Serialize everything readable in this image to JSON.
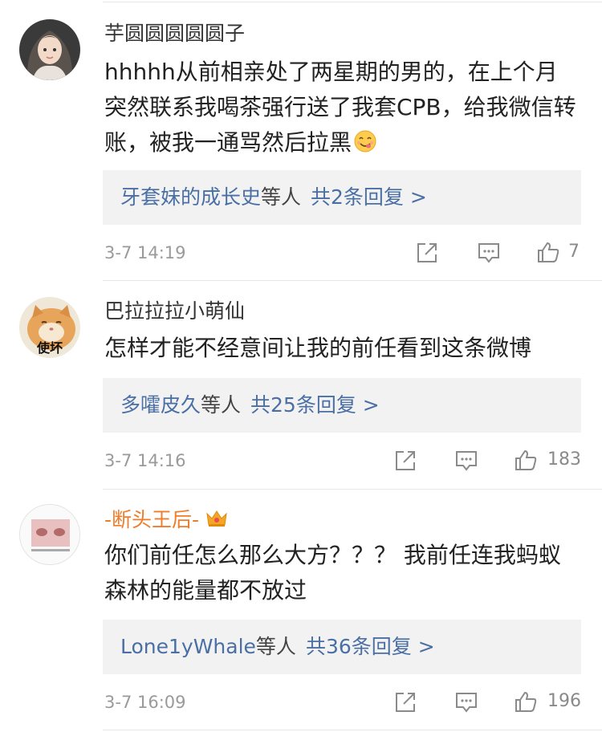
{
  "comments": [
    {
      "username": "芋圆圆圆圆圆子",
      "content": "hhhhh从前相亲处了两星期的男的，在上个月突然联系我喝茶强行送了我套CPB，给我微信转账，被我一通骂然后拉黑",
      "emoji": "yummy-face-emoji",
      "reply_names": "牙套妹的成长史",
      "reply_mid": "等人",
      "reply_count": "共2条回复 >",
      "time": "3-7 14:19",
      "likes": "7"
    },
    {
      "username": "巴拉拉拉小萌仙",
      "avatar_text": "使坏",
      "content": "怎样才能不经意间让我的前任看到这条微博",
      "reply_names": "多嚯皮久",
      "reply_mid": "等人",
      "reply_count": "共25条回复 >",
      "time": "3-7 14:16",
      "likes": "183"
    },
    {
      "username": "-断头王后-",
      "username_color": "#f07c2a",
      "badge": "crown-icon",
      "content": "你们前任怎么那么大方？？？ 我前任连我蚂蚁森林的能量都不放过",
      "reply_names": "Lone1yWhale",
      "reply_mid": "等人",
      "reply_count": "共36条回复 >",
      "time": "3-7 16:09",
      "likes": "196"
    }
  ]
}
